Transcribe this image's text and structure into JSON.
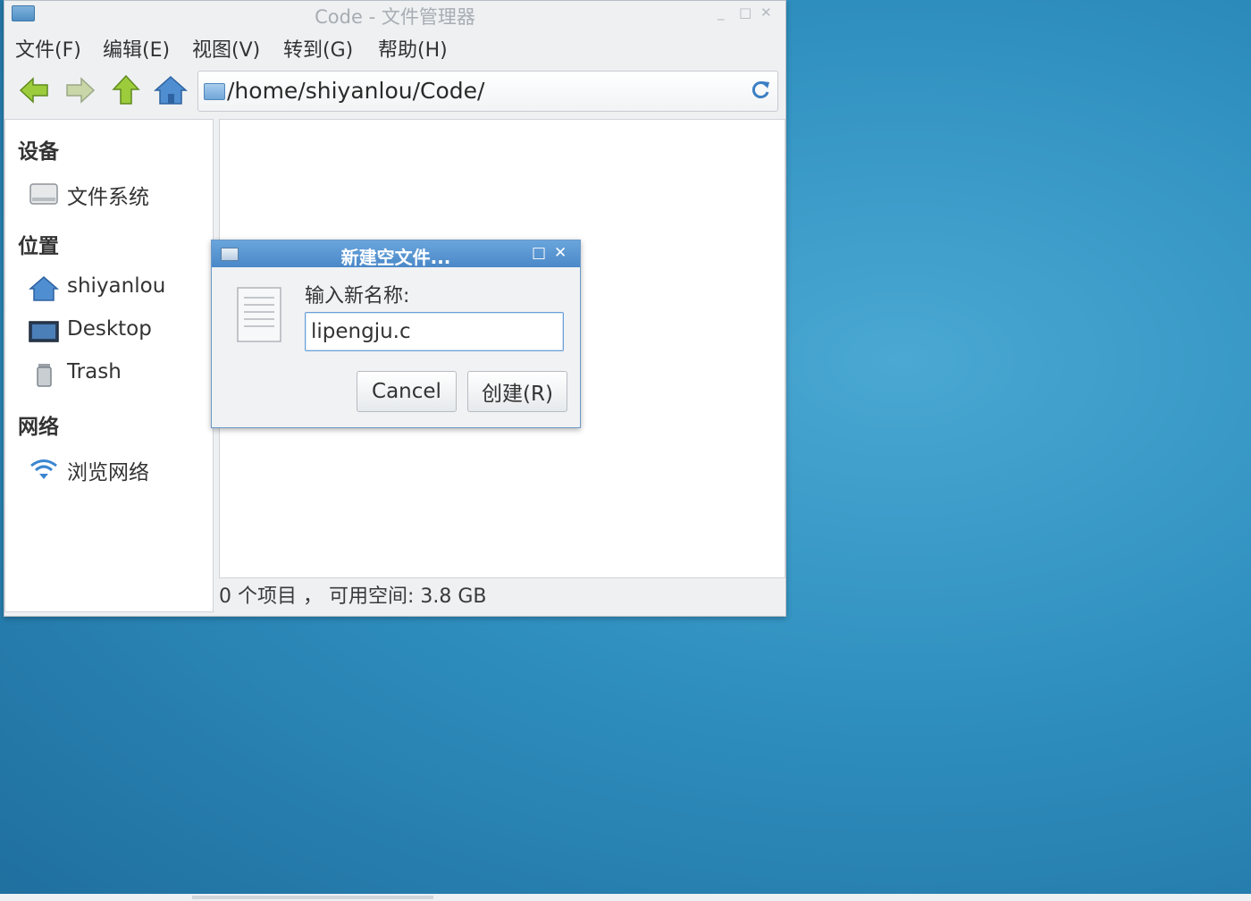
{
  "window": {
    "title": "Code - 文件管理器",
    "minimize": "_",
    "maximize": "□",
    "close": "✕"
  },
  "menu": [
    "文件(F)",
    "编辑(E)",
    "视图(V)",
    "转到(G)",
    "帮助(H)"
  ],
  "toolbar": {
    "icons": [
      "back-arrow-icon",
      "forward-arrow-icon",
      "up-arrow-icon",
      "home-icon"
    ],
    "location": "/home/shiyanlou/Code/",
    "refresh_icon": "refresh-icon"
  },
  "sidebar": {
    "devices_header": "设备",
    "devices": [
      {
        "label": "文件系统",
        "icon": "drive-icon"
      }
    ],
    "places_header": "位置",
    "places": [
      {
        "label": "shiyanlou",
        "icon": "home-folder-icon"
      },
      {
        "label": "Desktop",
        "icon": "desktop-icon"
      },
      {
        "label": "Trash",
        "icon": "trash-icon"
      }
    ],
    "network_header": "网络",
    "network": [
      {
        "label": "浏览网络",
        "icon": "wifi-icon"
      }
    ]
  },
  "status": "0 个项目 ， 可用空间: 3.8 GB",
  "dialog": {
    "title": "新建空文件...",
    "maximize": "□",
    "close": "✕",
    "prompt": "输入新名称:",
    "input_value": "lipengju.c",
    "cancel_label": "Cancel",
    "create_label": "创建(R)"
  },
  "colors": {
    "desktop": "#2f8fbf",
    "dialog_title": "#4a88c8",
    "toolbar_arrow": "#8cc63f"
  }
}
